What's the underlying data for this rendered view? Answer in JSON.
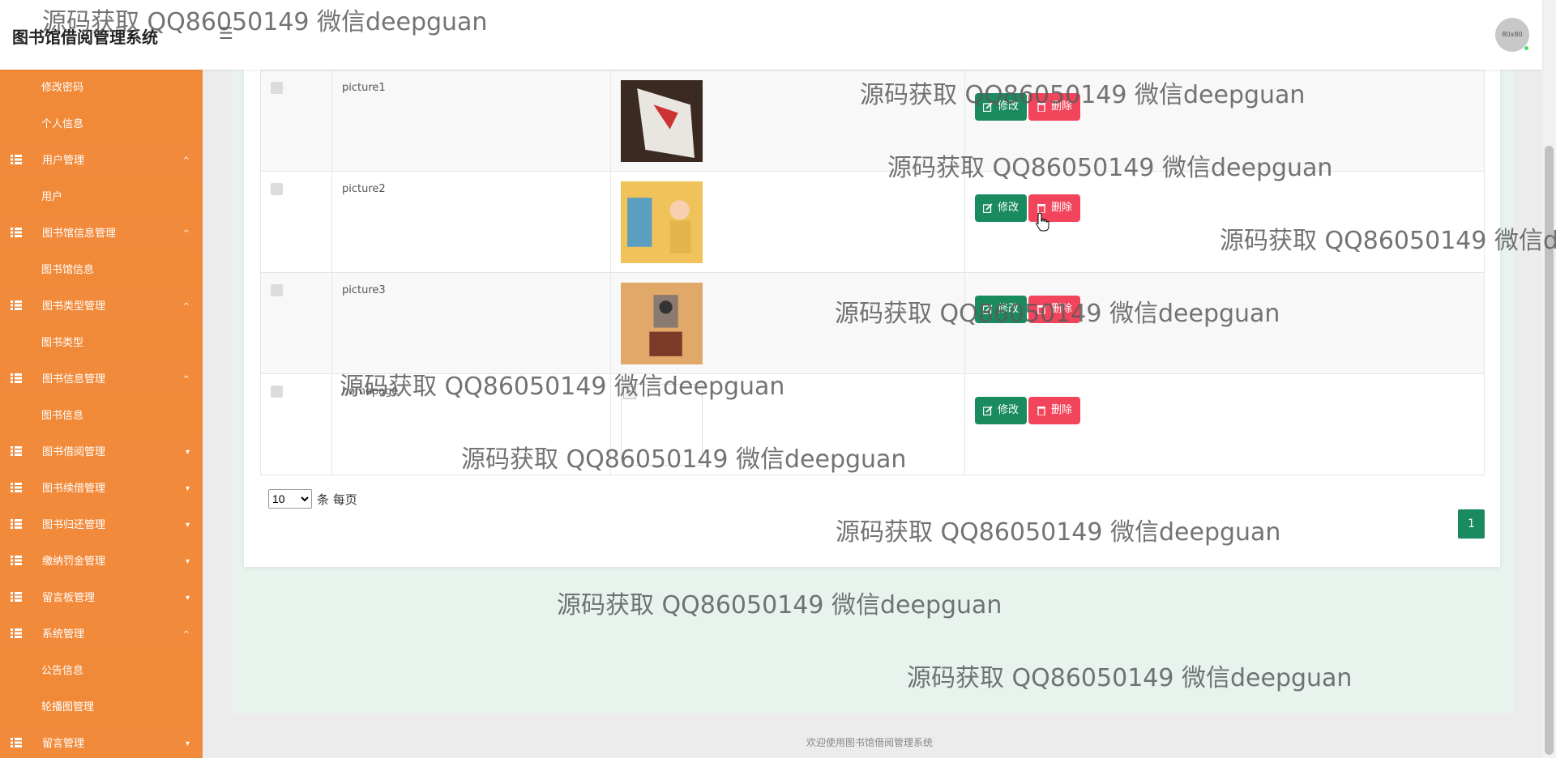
{
  "header": {
    "brand": "图书馆借阅管理系统",
    "avatar_text": "80x80",
    "menu_icon": "hamburger-icon"
  },
  "sidebar": {
    "items": [
      {
        "label": "修改密码",
        "kind": "sub"
      },
      {
        "label": "个人信息",
        "kind": "sub"
      },
      {
        "label": "用户管理",
        "kind": "group",
        "caret": "^"
      },
      {
        "label": "用户",
        "kind": "sub"
      },
      {
        "label": "图书馆信息管理",
        "kind": "group",
        "caret": "^"
      },
      {
        "label": "图书馆信息",
        "kind": "sub"
      },
      {
        "label": "图书类型管理",
        "kind": "group",
        "caret": "^"
      },
      {
        "label": "图书类型",
        "kind": "sub"
      },
      {
        "label": "图书信息管理",
        "kind": "group",
        "caret": "^"
      },
      {
        "label": "图书信息",
        "kind": "sub"
      },
      {
        "label": "图书借阅管理",
        "kind": "group",
        "caret": "▾"
      },
      {
        "label": "图书续借管理",
        "kind": "group",
        "caret": "▾"
      },
      {
        "label": "图书归还管理",
        "kind": "group",
        "caret": "▾"
      },
      {
        "label": "缴纳罚金管理",
        "kind": "group",
        "caret": "▾"
      },
      {
        "label": "留言板管理",
        "kind": "group",
        "caret": "▾"
      },
      {
        "label": "系统管理",
        "kind": "group",
        "caret": "^"
      },
      {
        "label": "公告信息",
        "kind": "sub"
      },
      {
        "label": "轮播图管理",
        "kind": "sub"
      },
      {
        "label": "留言管理",
        "kind": "group",
        "caret": "▾"
      }
    ]
  },
  "table": {
    "rows": [
      {
        "name": "picture1",
        "image": "thumb-1"
      },
      {
        "name": "picture2",
        "image": "thumb-2"
      },
      {
        "name": "picture3",
        "image": "thumb-3"
      },
      {
        "name": "homepage",
        "image": "broken"
      }
    ],
    "edit_label": "修改",
    "delete_label": "删除"
  },
  "pager": {
    "page_size": "10",
    "page_size_options": [
      "10"
    ],
    "per_page_text": "条 每页",
    "current_page": "1"
  },
  "footer": {
    "text": "欢迎使用图书馆借阅管理系统"
  },
  "watermark": {
    "text": "源码获取 QQ86050149 微信deepguan"
  },
  "colors": {
    "sidebar": "#f08a3c",
    "edit_button": "#1a8a5f",
    "delete_button": "#f2455c",
    "content_bg": "#e8f3ee"
  }
}
